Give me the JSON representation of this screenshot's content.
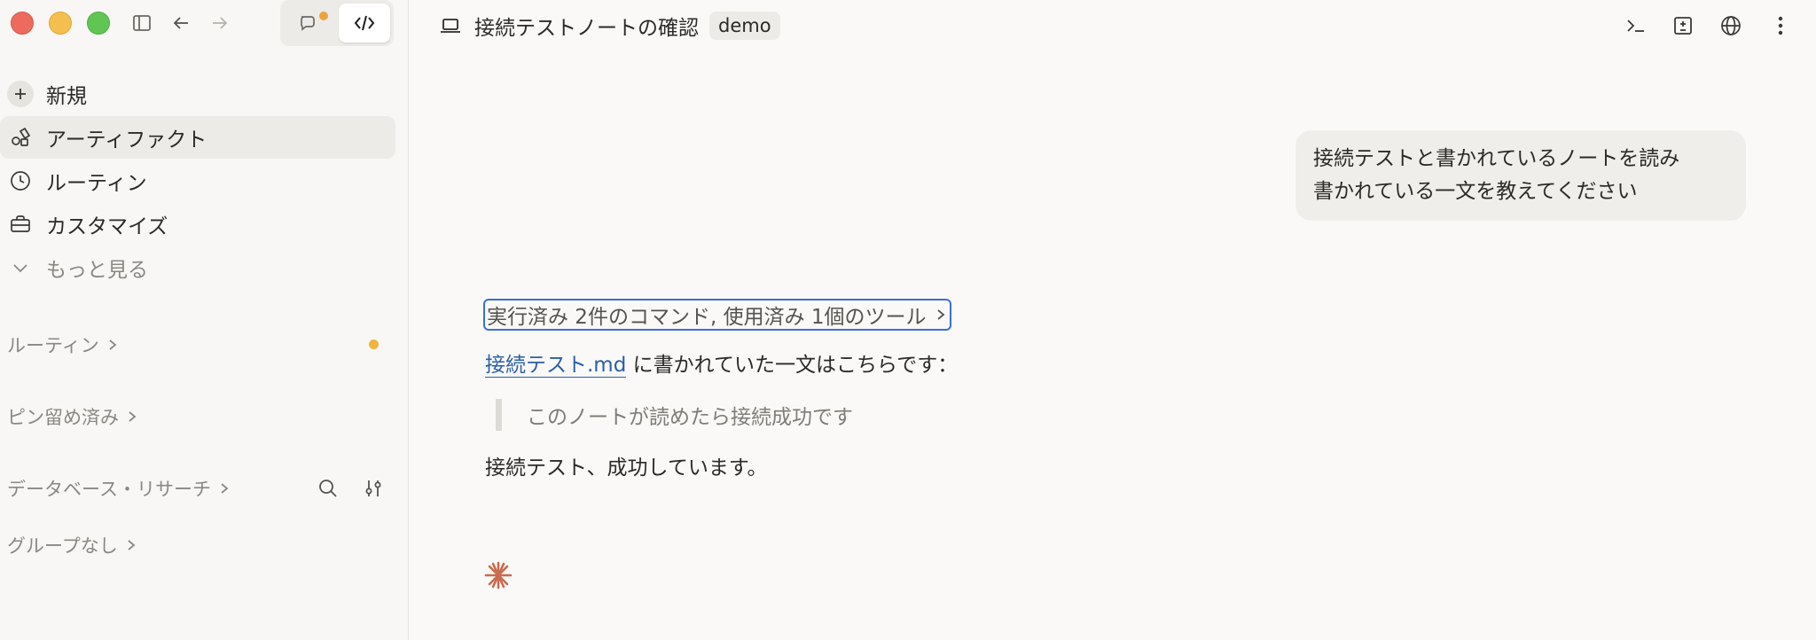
{
  "sidebar": {
    "nav": [
      {
        "label": "新規",
        "icon": "plus-icon"
      },
      {
        "label": "アーティファクト",
        "icon": "artifacts-icon",
        "active": true
      },
      {
        "label": "ルーティン",
        "icon": "clock-icon"
      },
      {
        "label": "カスタマイズ",
        "icon": "briefcase-icon"
      },
      {
        "label": "もっと見る",
        "icon": "chevron-down-icon"
      }
    ],
    "sections": [
      {
        "label": "ルーティン"
      },
      {
        "label": "ピン留め済み"
      },
      {
        "label": "データベース・リサーチ"
      },
      {
        "label": "グループなし"
      }
    ]
  },
  "header": {
    "title": "接続テストノートの確認",
    "badge": "demo"
  },
  "chat": {
    "user_message_line1": "接続テストと書かれているノートを読み",
    "user_message_line2": "書かれている一文を教えてください",
    "tools_summary": "実行済み 2件のコマンド, 使用済み 1個のツール",
    "answer_link": "接続テスト.md",
    "answer_text": " に書かれていた一文はこちらです：",
    "quote": "このノートが読めたら接続成功です",
    "closing": "接続テスト、成功しています。"
  },
  "colors": {
    "accent_link": "#2a5fa8",
    "focus_ring": "#3b6fd4",
    "notification": "#f0b43f",
    "spark": "#c96b4e"
  }
}
